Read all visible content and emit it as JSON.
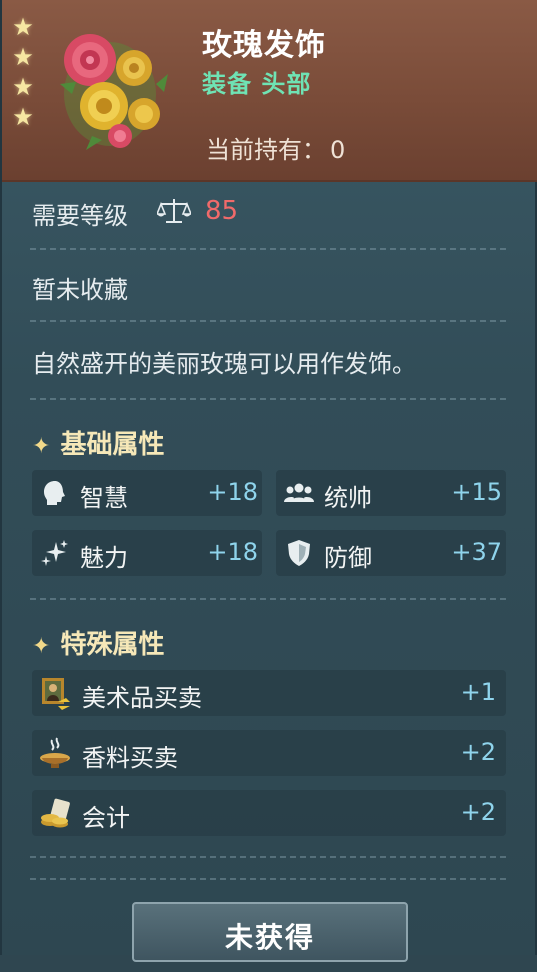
{
  "header": {
    "stars": [
      "★",
      "★",
      "★",
      "★"
    ],
    "item_name": "玫瑰发饰",
    "item_type": "装备 头部",
    "holding_label": "当前持有：",
    "holding_count": "0"
  },
  "level": {
    "label": "需要等级",
    "value": "85"
  },
  "collect_status": "暂未收藏",
  "description": "自然盛开的美丽玫瑰可以用作发饰。",
  "basic_attrs": {
    "title": "基础属性",
    "items": [
      {
        "label": "智慧",
        "value": "+18",
        "icon": "head-icon"
      },
      {
        "label": "统帅",
        "value": "+15",
        "icon": "group-icon"
      },
      {
        "label": "魅力",
        "value": "+18",
        "icon": "sparkle-icon"
      },
      {
        "label": "防御",
        "value": "+37",
        "icon": "shield-icon"
      }
    ]
  },
  "special_attrs": {
    "title": "特殊属性",
    "items": [
      {
        "label": "美术品买卖",
        "value": "+1",
        "icon": "painting-icon"
      },
      {
        "label": "香料买卖",
        "value": "+2",
        "icon": "incense-icon"
      },
      {
        "label": "会计",
        "value": "+2",
        "icon": "coins-icon"
      }
    ]
  },
  "button_label": "未获得",
  "colors": {
    "header_bg": "#7a4c39",
    "panel_bg": "#324d58",
    "type_green": "#6fe3b4",
    "level_red": "#f06a6a",
    "value_blue": "#8fd4ec"
  }
}
